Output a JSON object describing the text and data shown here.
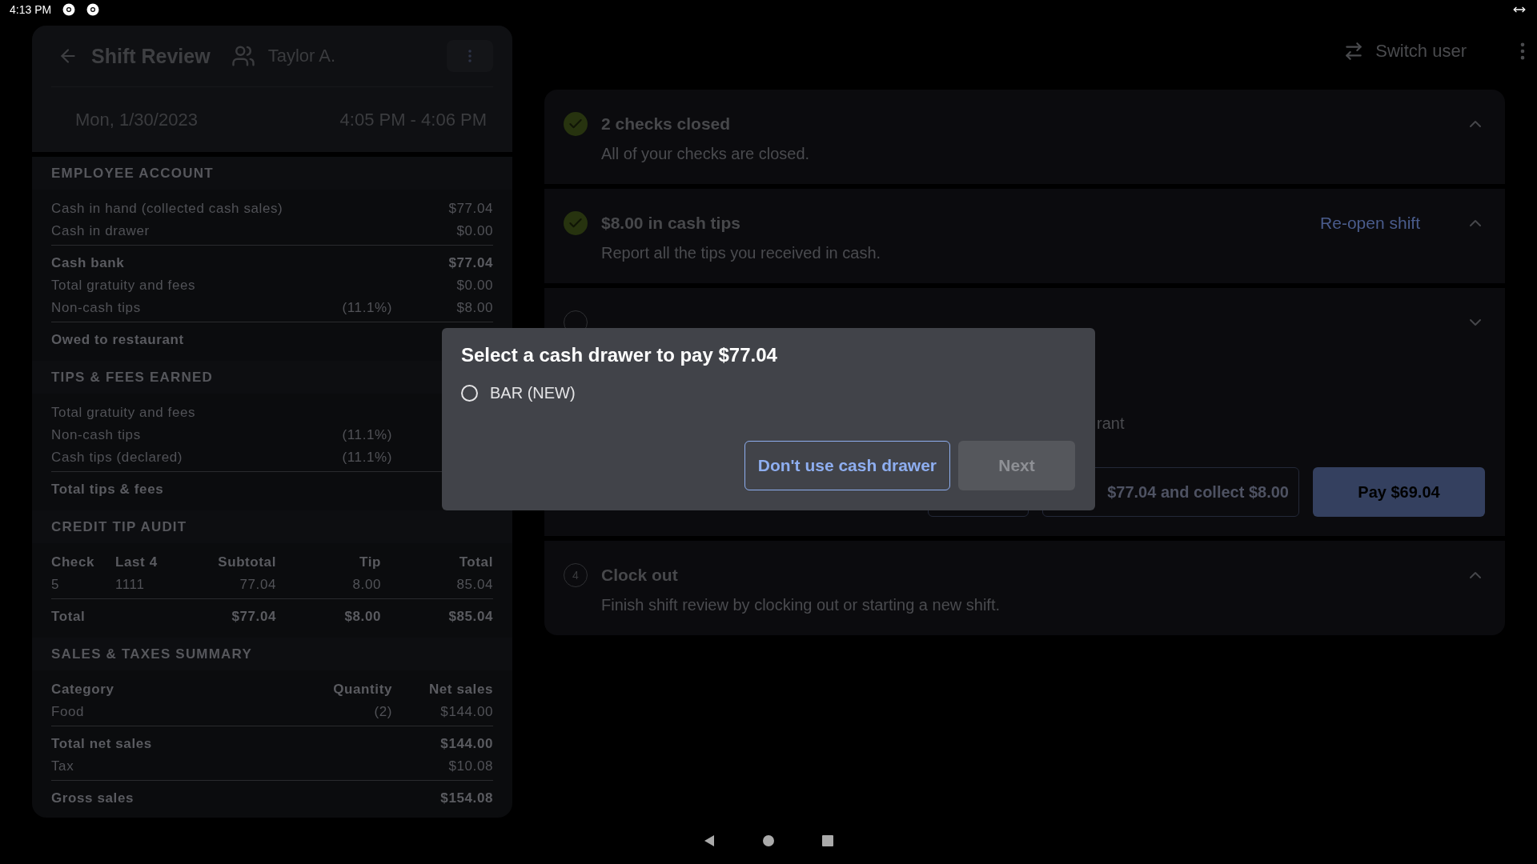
{
  "status_bar": {
    "time": "4:13 PM"
  },
  "shift_panel": {
    "title": "Shift Review",
    "employee": "Taylor A.",
    "date": "Mon, 1/30/2023",
    "time_range": "4:05 PM - 4:06 PM",
    "sections": [
      {
        "heading": "EMPLOYEE ACCOUNT",
        "kind": "list",
        "groups": [
          [
            {
              "label": "Cash in hand (collected cash sales)",
              "value": "$77.04",
              "bold": false
            },
            {
              "label": "Cash in drawer",
              "value": "$0.00",
              "bold": false
            }
          ],
          [
            {
              "label": "Cash bank",
              "value": "$77.04",
              "bold": true
            },
            {
              "label": "Total gratuity and fees",
              "value": "$0.00",
              "bold": false
            },
            {
              "label": "Non-cash tips",
              "note": "(11.1%)",
              "value": "$8.00",
              "bold": false
            }
          ],
          [
            {
              "label": "Owed to restaurant",
              "bold": true
            }
          ]
        ]
      },
      {
        "heading": "TIPS & FEES EARNED",
        "kind": "list",
        "groups": [
          [
            {
              "label": "Total gratuity and fees",
              "bold": false
            },
            {
              "label": "Non-cash tips",
              "note": "(11.1%)",
              "bold": false
            },
            {
              "label": "Cash tips (declared)",
              "note": "(11.1%)",
              "bold": false
            }
          ],
          [
            {
              "label": "Total tips & fees",
              "bold": true
            }
          ]
        ]
      },
      {
        "heading": "CREDIT TIP AUDIT",
        "kind": "table",
        "groups": [
          [
            {
              "cells": [
                "Check",
                "Last 4",
                "Subtotal",
                "Tip",
                "Total"
              ],
              "bold": true
            },
            {
              "cells": [
                "5",
                "1111",
                "77.04",
                "8.00",
                "85.04"
              ],
              "bold": false
            }
          ],
          [
            {
              "cells": [
                "Total",
                null,
                "$77.04",
                "$8.00",
                "$85.04"
              ],
              "bold": true
            }
          ]
        ]
      },
      {
        "heading": "SALES & TAXES SUMMARY",
        "kind": "list",
        "groups": [
          [
            {
              "label": "Category",
              "note": "Quantity",
              "value": "Net sales",
              "bold": true
            },
            {
              "label": "Food",
              "note": "(2)",
              "value": "$144.00",
              "bold": false
            }
          ],
          [
            {
              "label": "Total net sales",
              "value": "$144.00",
              "bold": true
            },
            {
              "label": "Tax",
              "value": "$10.08",
              "bold": false
            }
          ],
          [
            {
              "label": "Gross sales",
              "value": "$154.08",
              "bold": true
            }
          ]
        ]
      }
    ]
  },
  "top_bar": {
    "switch_user": "Switch user"
  },
  "steps": [
    {
      "kind": "done",
      "title": "2 checks closed",
      "description": "All of your checks are closed.",
      "expanded": true
    },
    {
      "kind": "done",
      "title": "$8.00 in cash tips",
      "description": "Report all the tips you received in cash.",
      "link": "Re-open shift",
      "expanded": true
    },
    {
      "kind": "pending",
      "description": "rant",
      "expanded": false,
      "actions": [
        {
          "kind": "outline"
        },
        {
          "kind": "outline",
          "label": "$77.04 and collect $8.00"
        },
        {
          "kind": "filled",
          "label": "Pay $69.04"
        }
      ]
    },
    {
      "kind": "pending",
      "number": "4",
      "title": "Clock out",
      "description": "Finish shift review by clocking out or starting a new shift.",
      "expanded": true
    }
  ],
  "dialog": {
    "title": "Select a cash drawer to pay $77.04",
    "options": [
      {
        "label": "BAR (NEW)",
        "selected": false
      }
    ],
    "buttons": [
      {
        "label": "Don't use cash drawer",
        "disabled": false
      },
      {
        "label": "Next",
        "disabled": true
      }
    ]
  }
}
